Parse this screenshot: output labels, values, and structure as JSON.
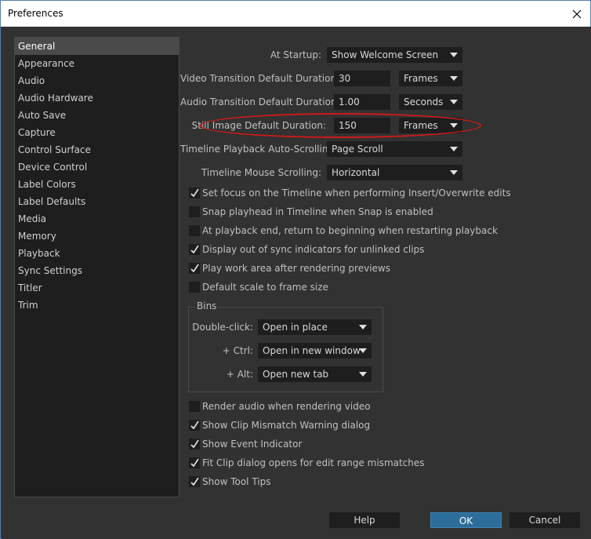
{
  "window": {
    "title": "Preferences"
  },
  "sidebar": {
    "items": [
      {
        "label": "General",
        "selected": true
      },
      {
        "label": "Appearance"
      },
      {
        "label": "Audio"
      },
      {
        "label": "Audio Hardware"
      },
      {
        "label": "Auto Save"
      },
      {
        "label": "Capture"
      },
      {
        "label": "Control Surface"
      },
      {
        "label": "Device Control"
      },
      {
        "label": "Label Colors"
      },
      {
        "label": "Label Defaults"
      },
      {
        "label": "Media"
      },
      {
        "label": "Memory"
      },
      {
        "label": "Playback"
      },
      {
        "label": "Sync Settings"
      },
      {
        "label": "Titler"
      },
      {
        "label": "Trim"
      }
    ]
  },
  "general": {
    "startup": {
      "label": "At Startup:",
      "value": "Show Welcome Screen"
    },
    "video_transition": {
      "label": "Video Transition Default Duration:",
      "value": "30",
      "unit": "Frames"
    },
    "audio_transition": {
      "label": "Audio Transition Default Duration:",
      "value": "1.00",
      "unit": "Seconds"
    },
    "still_image": {
      "label": "Still Image Default Duration:",
      "value": "150",
      "unit": "Frames"
    },
    "playback_scroll": {
      "label": "Timeline Playback Auto-Scrolling:",
      "value": "Page Scroll"
    },
    "mouse_scroll": {
      "label": "Timeline Mouse Scrolling:",
      "value": "Horizontal"
    },
    "checks1": [
      {
        "label": "Set focus on the Timeline when performing Insert/Overwrite edits",
        "checked": true
      },
      {
        "label": "Snap playhead in Timeline when Snap is enabled",
        "checked": false
      },
      {
        "label": "At playback end, return to beginning when restarting playback",
        "checked": false
      },
      {
        "label": "Display out of sync indicators for unlinked clips",
        "checked": true
      },
      {
        "label": "Play work area after rendering previews",
        "checked": true
      },
      {
        "label": "Default scale to frame size",
        "checked": false
      }
    ],
    "bins": {
      "title": "Bins",
      "double_click": {
        "label": "Double-click:",
        "value": "Open in place"
      },
      "ctrl": {
        "label": "+ Ctrl:",
        "value": "Open in new window"
      },
      "alt": {
        "label": "+ Alt:",
        "value": "Open new tab"
      }
    },
    "checks2": [
      {
        "label": "Render audio when rendering video",
        "checked": false
      },
      {
        "label": "Show Clip Mismatch Warning dialog",
        "checked": true
      },
      {
        "label": "Show Event Indicator",
        "checked": true
      },
      {
        "label": "Fit Clip dialog opens for edit range mismatches",
        "checked": true
      },
      {
        "label": "Show Tool Tips",
        "checked": true
      }
    ]
  },
  "buttons": {
    "help": "Help",
    "ok": "OK",
    "cancel": "Cancel"
  },
  "colors": {
    "background": "#323232",
    "field": "#1e1e1e",
    "accent": "#2d6d9a",
    "annotation": "#cc1a1a"
  }
}
